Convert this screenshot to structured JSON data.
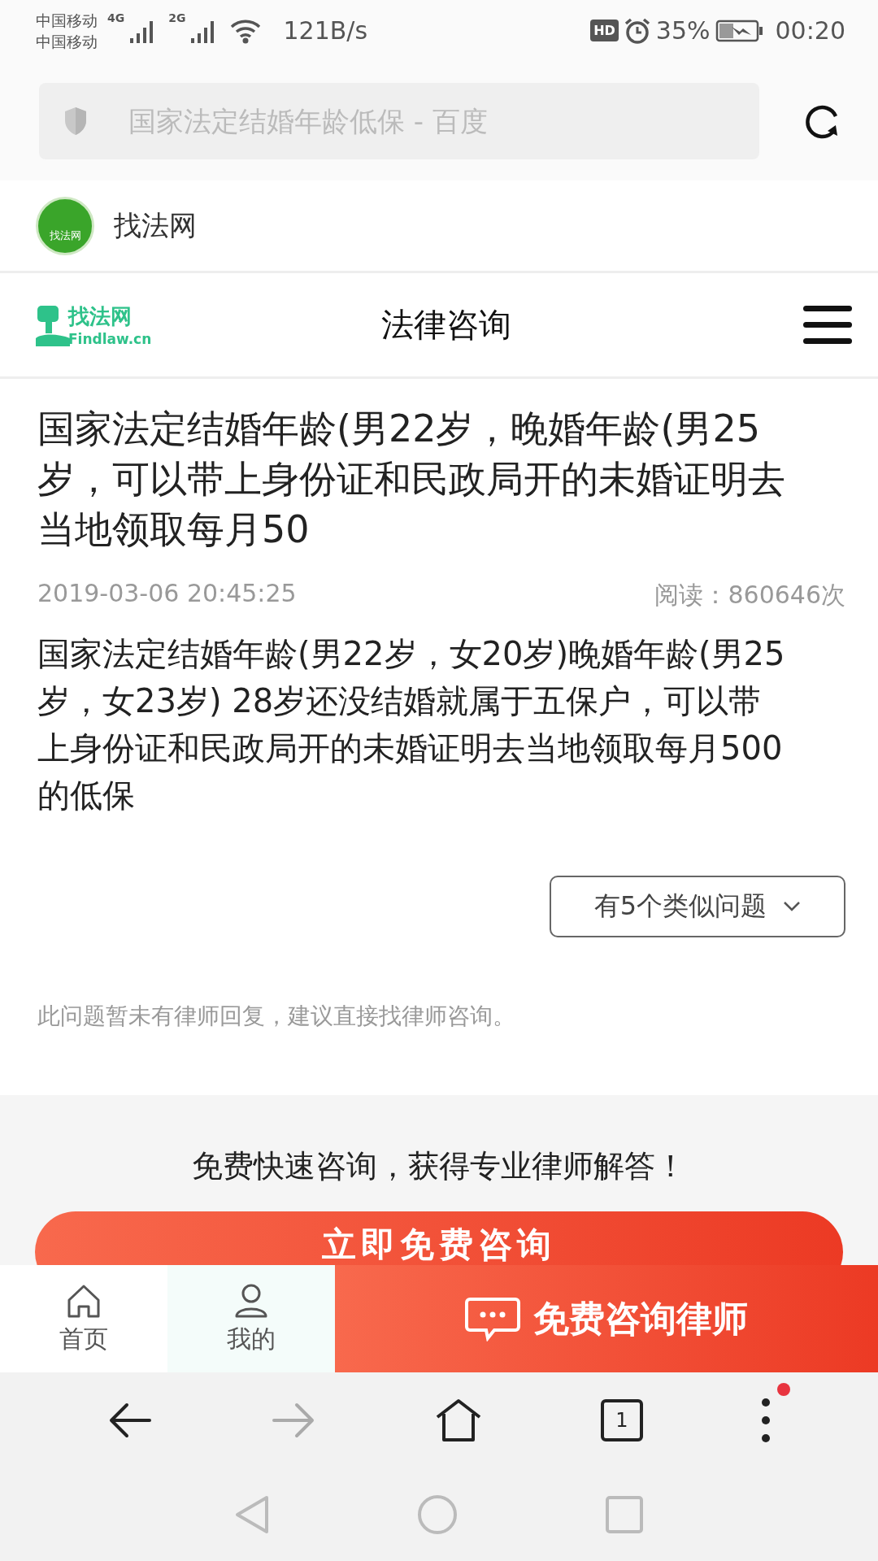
{
  "status_bar": {
    "carriers": [
      "中国移动",
      "中国移动"
    ],
    "networks": [
      "4G",
      "2G"
    ],
    "speed": "121B/s",
    "hd": "HD",
    "battery": "35%",
    "time": "00:20"
  },
  "address_bar": {
    "placeholder": "国家法定结婚年龄低保 - 百度"
  },
  "site": {
    "name": "找法网",
    "badge": "找法网"
  },
  "header": {
    "logo_cn": "找法网",
    "logo_en": "Findlaw.cn",
    "title": "法律咨询"
  },
  "question": {
    "title": "国家法定结婚年龄(男22岁，晚婚年龄(男25岁，可以带上身份证和民政局开的未婚证明去当地领取每月50",
    "date": "2019-03-06 20:45:25",
    "reads": "阅读：860646次",
    "body": "国家法定结婚年龄(男22岁，女20岁)晚婚年龄(男25岁，女23岁) 28岁还没结婚就属于五保户，可以带上身份证和民政局开的未婚证明去当地领取每月500的低保",
    "similar": "有5个类似问题",
    "note": "此问题暂未有律师回复，建议直接找律师咨询。"
  },
  "promo": {
    "heading": "免费快速咨询，获得专业律师解答！",
    "button": "立即免费咨询"
  },
  "bottom_tabs": [
    {
      "kind": "home",
      "label": "首页"
    },
    {
      "kind": "user",
      "label": "我的"
    }
  ],
  "cta": "免费咨询律师",
  "browser_nav": {
    "tabs_count": "1",
    "menu_badge": true
  }
}
